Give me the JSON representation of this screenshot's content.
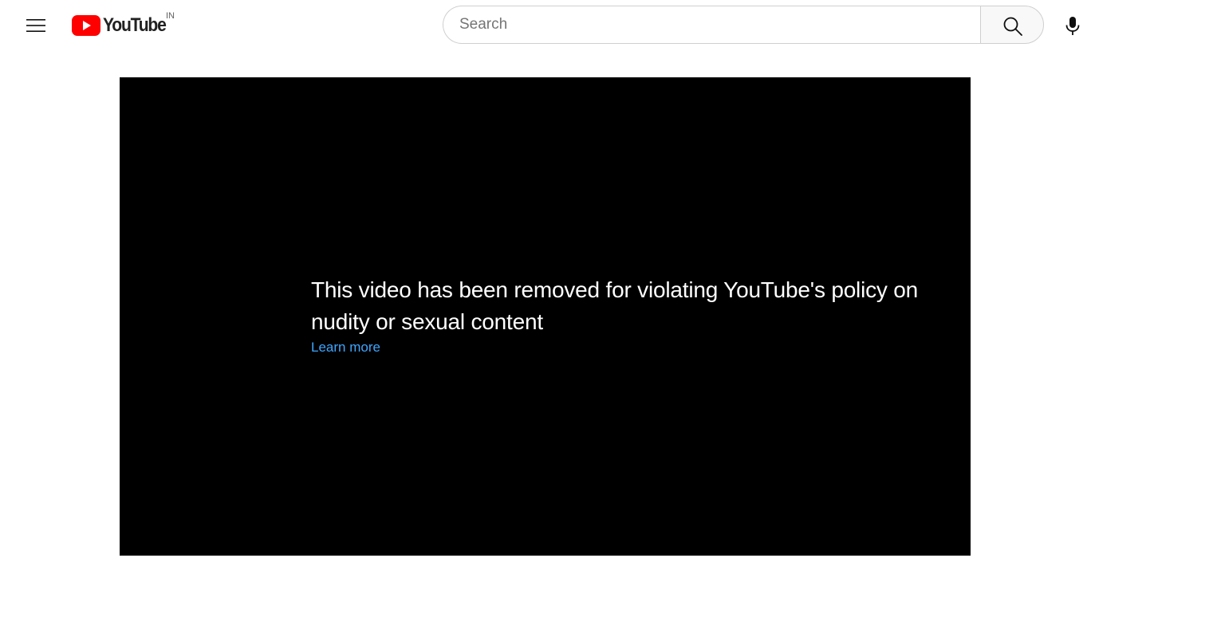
{
  "masthead": {
    "logo_text": "YouTube",
    "country_code": "IN",
    "search": {
      "placeholder": "Search",
      "value": ""
    },
    "icons": {
      "menu": "hamburger-menu-icon",
      "logo": "youtube-play-icon",
      "search": "magnifier-icon",
      "voice": "microphone-icon"
    }
  },
  "player": {
    "error_reason": "This video has been removed for violating YouTube's policy on nudity or sexual content",
    "learn_more_label": "Learn more"
  },
  "colors": {
    "brand_red": "#ff0000",
    "link_blue": "#3ea6ff",
    "player_bg": "#000000"
  }
}
